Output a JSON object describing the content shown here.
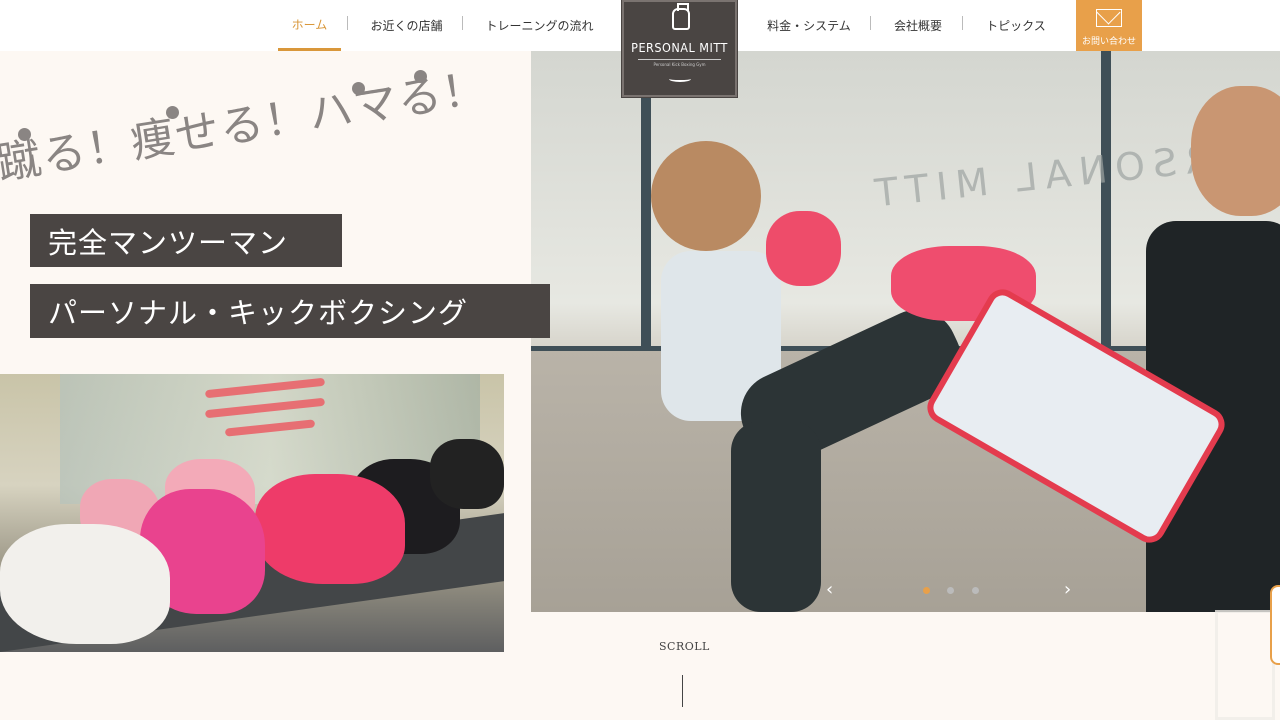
{
  "nav": {
    "items": [
      {
        "label": "ホーム",
        "active": true
      },
      {
        "label": "お近くの店舗"
      },
      {
        "label": "トレーニングの流れ"
      },
      {
        "label": "料金・システム"
      },
      {
        "label": "会社概要"
      },
      {
        "label": "トピックス"
      }
    ],
    "contact_label": "お問い合わせ",
    "contact_icon": "envelope-icon"
  },
  "logo": {
    "name": "PERSONAL MITT",
    "sub": "Personal Kick Boxing Gym"
  },
  "hero": {
    "catchcopy": "蹴る！痩せる！ハマる！",
    "tag1": "完全マンツーマン",
    "tag2": "パーソナル・キックボクシング",
    "photo_text": "PERSONAL MITT"
  },
  "slider": {
    "prev": "‹",
    "next": "›",
    "dots": 3,
    "current": 1
  },
  "scroll_label": "SCROLL",
  "colors": {
    "accent": "#e8a04a",
    "dark": "#4a4543",
    "background": "#fdf8f3"
  }
}
